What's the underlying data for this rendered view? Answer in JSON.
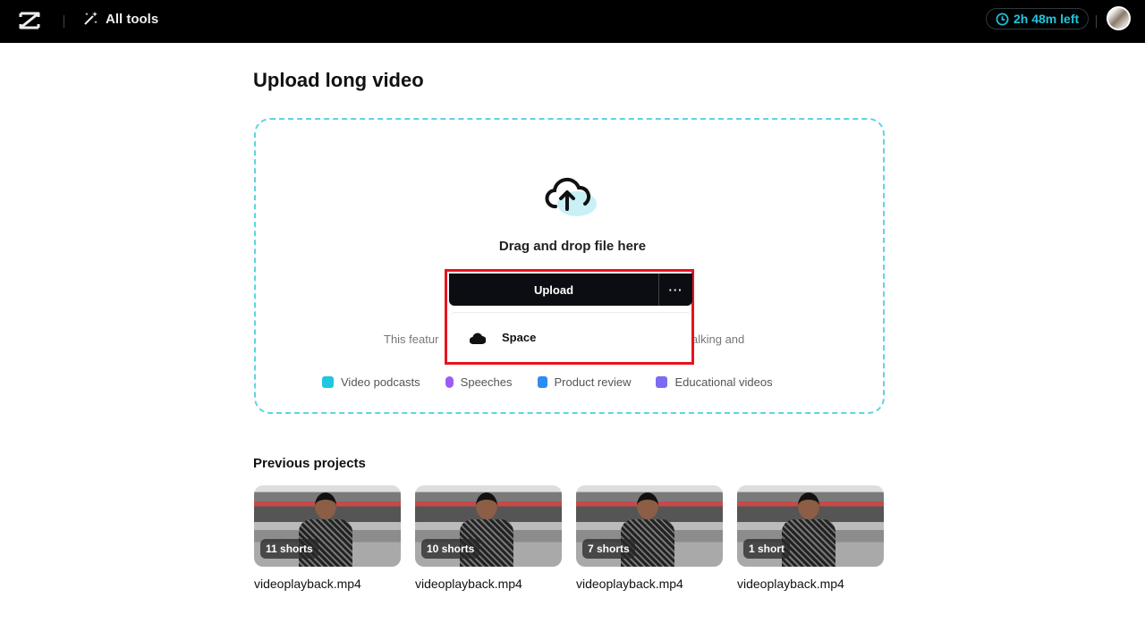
{
  "topbar": {
    "logo_icon": "capcut-logo",
    "all_tools_label": "All tools",
    "all_tools_icon": "magic-wand-icon",
    "timer_label": "2h 48m left",
    "timer_icon": "clock-icon",
    "accent": "#1fc6e0"
  },
  "page": {
    "title": "Upload long video"
  },
  "upload": {
    "drag_text": "Drag and drop file here",
    "upload_label": "Upload",
    "more_label": "···",
    "menu_items": [
      {
        "label": "Space",
        "icon": "cloud-icon"
      }
    ],
    "description_left": "This featur",
    "description_right": "alking and",
    "tags": [
      {
        "label": "Video podcasts",
        "color": "#1fc6e0"
      },
      {
        "label": "Speeches",
        "color": "#9b5cf5"
      },
      {
        "label": "Product review",
        "color": "#2d8cf0"
      },
      {
        "label": "Educational videos",
        "color": "#7b6cf0"
      }
    ]
  },
  "previous": {
    "title": "Previous projects",
    "items": [
      {
        "badge": "11 shorts",
        "name": "videoplayback.mp4"
      },
      {
        "badge": "10 shorts",
        "name": "videoplayback.mp4"
      },
      {
        "badge": "7 shorts",
        "name": "videoplayback.mp4"
      },
      {
        "badge": "1 short",
        "name": "videoplayback.mp4"
      }
    ]
  }
}
